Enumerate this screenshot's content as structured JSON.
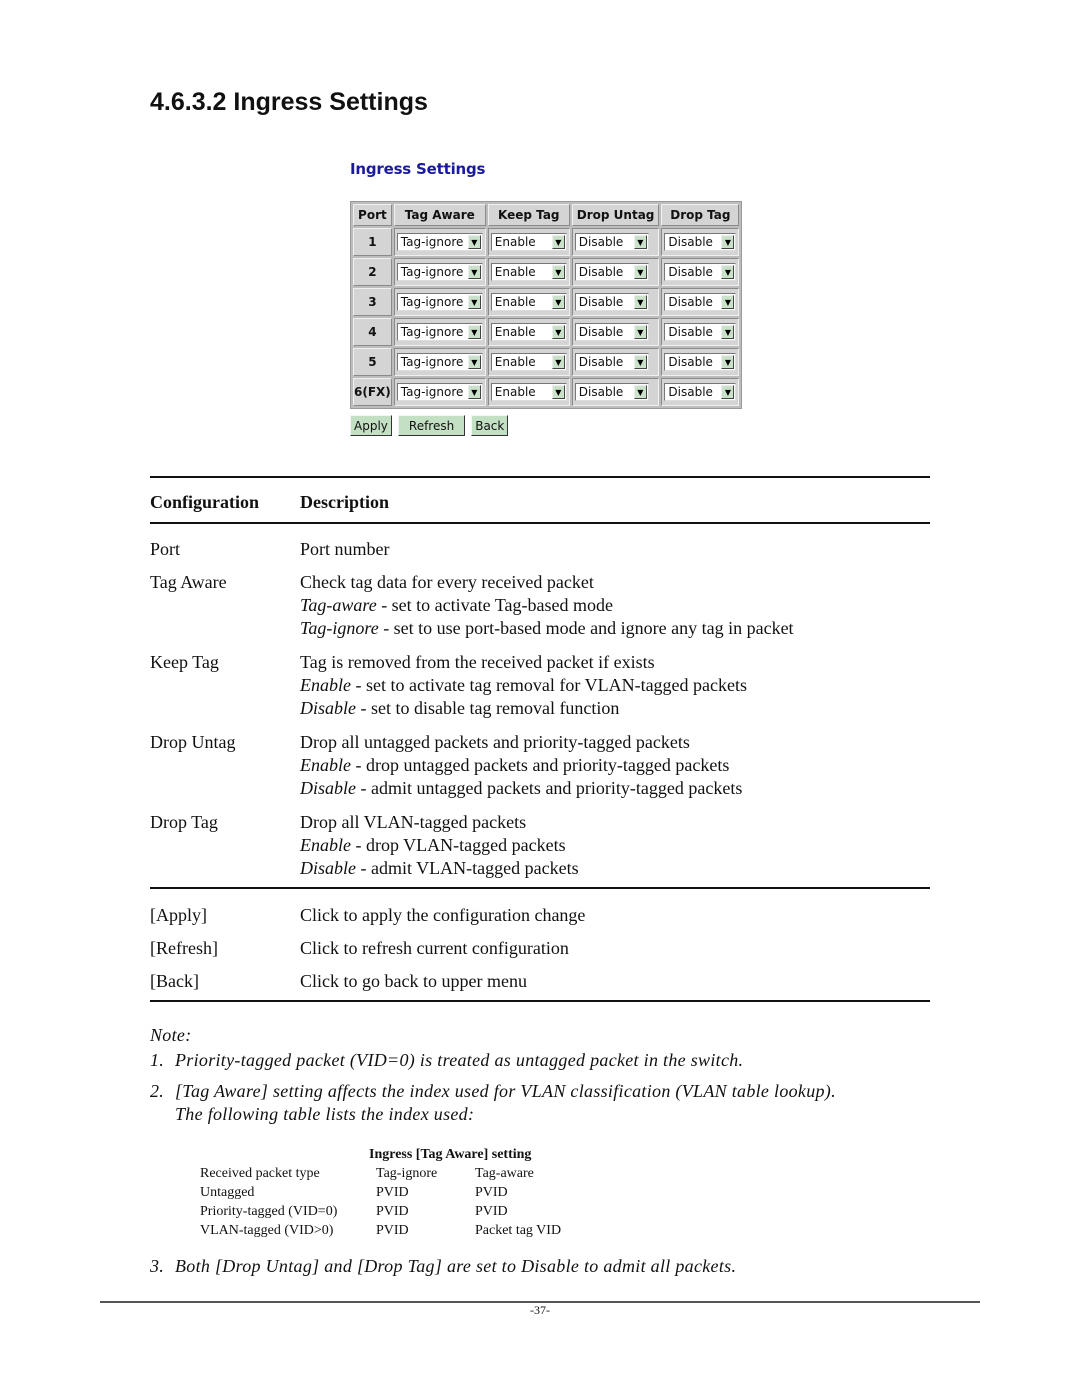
{
  "section_title": "4.6.3.2 Ingress Settings",
  "ui": {
    "title": "Ingress Settings",
    "columns": [
      "Port",
      "Tag Aware",
      "Keep Tag",
      "Drop Untag",
      "Drop Tag"
    ],
    "rows": [
      {
        "port": "1",
        "tag_aware": "Tag-ignore",
        "keep_tag": "Enable",
        "drop_untag": "Disable",
        "drop_tag": "Disable"
      },
      {
        "port": "2",
        "tag_aware": "Tag-ignore",
        "keep_tag": "Enable",
        "drop_untag": "Disable",
        "drop_tag": "Disable"
      },
      {
        "port": "3",
        "tag_aware": "Tag-ignore",
        "keep_tag": "Enable",
        "drop_untag": "Disable",
        "drop_tag": "Disable"
      },
      {
        "port": "4",
        "tag_aware": "Tag-ignore",
        "keep_tag": "Enable",
        "drop_untag": "Disable",
        "drop_tag": "Disable"
      },
      {
        "port": "5",
        "tag_aware": "Tag-ignore",
        "keep_tag": "Enable",
        "drop_untag": "Disable",
        "drop_tag": "Disable"
      },
      {
        "port": "6(FX)",
        "tag_aware": "Tag-ignore",
        "keep_tag": "Enable",
        "drop_untag": "Disable",
        "drop_tag": "Disable"
      }
    ],
    "buttons": {
      "apply": "Apply",
      "refresh": "Refresh",
      "back": "Back"
    },
    "colors": {
      "title": "#1a1a9a",
      "button_bg": "#c4e0c4",
      "header_bg": "#d4d4d4"
    }
  },
  "config_table": {
    "headers": {
      "configuration": "Configuration",
      "description": "Description"
    },
    "port": {
      "label": "Port",
      "desc": "Port number"
    },
    "tag_aware": {
      "label": "Tag Aware",
      "desc": "Check tag data for every received packet",
      "opt1_name": "Tag-aware",
      "opt1_text": " - set to activate Tag-based mode",
      "opt2_name": "Tag-ignore",
      "opt2_text": " - set to use port-based mode and ignore any tag in packet"
    },
    "keep_tag": {
      "label": "Keep Tag",
      "desc": "Tag is removed from the received packet if exists",
      "opt1_name": "Enable",
      "opt1_text": " - set to activate tag removal for VLAN-tagged packets",
      "opt2_name": "Disable",
      "opt2_text": " - set to disable tag removal function"
    },
    "drop_untag": {
      "label": "Drop Untag",
      "desc": "Drop all untagged packets and priority-tagged packets",
      "opt1_name": "Enable",
      "opt1_text": " - drop untagged packets and priority-tagged packets",
      "opt2_name": "Disable",
      "opt2_text": " - admit untagged packets and priority-tagged packets"
    },
    "drop_tag": {
      "label": "Drop Tag",
      "desc": "Drop all VLAN-tagged packets",
      "opt1_name": "Enable",
      "opt1_text": " - drop VLAN-tagged packets",
      "opt2_name": "Disable",
      "opt2_text": " - admit VLAN-tagged packets"
    },
    "apply": {
      "label": "[Apply]",
      "desc": "Click to apply the configuration change"
    },
    "refresh": {
      "label": "[Refresh]",
      "desc": "Click to refresh current configuration"
    },
    "back": {
      "label": "[Back]",
      "desc": "Click to go back to upper menu"
    }
  },
  "notes": {
    "heading": "Note:",
    "n1_num": "1.",
    "n1": "Priority-tagged packet (VID=0) is treated as untagged packet in the switch.",
    "n2_num": "2.",
    "n2a": "[Tag Aware] setting affects the index used for VLAN classification (VLAN table lookup).",
    "n2b": "The following table lists the index used:",
    "n3_num": "3.",
    "n3": "Both [Drop Untag] and [Drop Tag] are set to Disable to admit all packets."
  },
  "index_table": {
    "group_header": "Ingress [Tag Aware] setting",
    "headers": [
      "Received packet type",
      "Tag-ignore",
      "Tag-aware"
    ],
    "rows": [
      [
        "Untagged",
        "PVID",
        "PVID"
      ],
      [
        "Priority-tagged (VID=0)",
        "PVID",
        "PVID"
      ],
      [
        "VLAN-tagged (VID>0)",
        "PVID",
        "Packet tag VID"
      ]
    ]
  },
  "page_number": "-37-"
}
